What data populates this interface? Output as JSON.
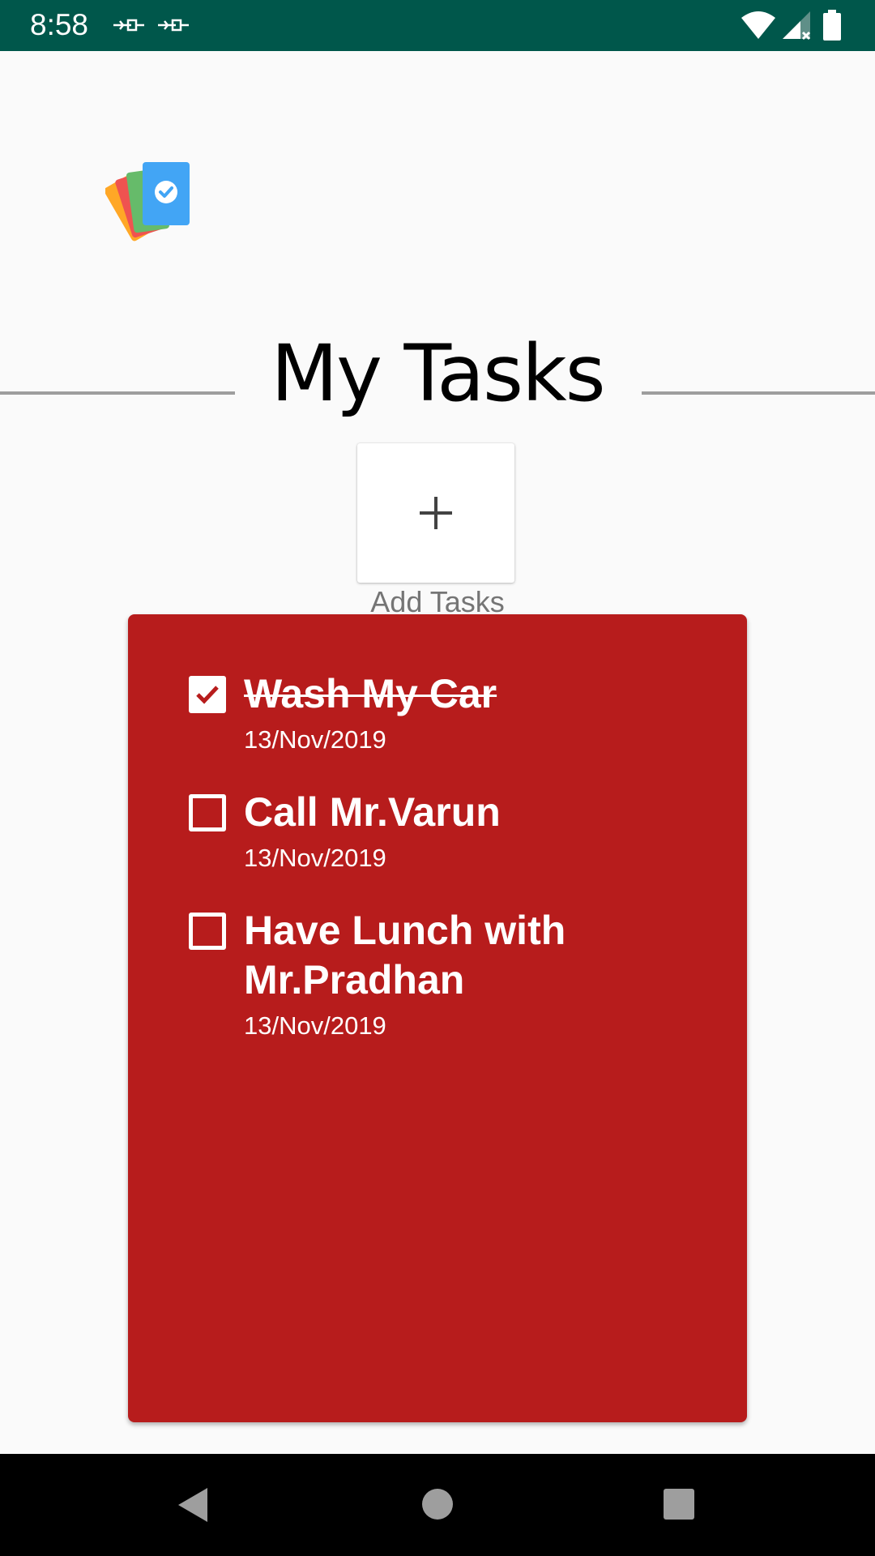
{
  "status_bar": {
    "time": "8:58",
    "notification_icons": [
      "usb-debug-icon",
      "usb-debug-icon"
    ],
    "system_icons": [
      "wifi-icon",
      "cellular-signal-icon",
      "battery-icon"
    ],
    "background": "#00574b"
  },
  "header": {
    "logo_icon": "task-cards-logo-icon",
    "title": "My Tasks"
  },
  "add_task": {
    "icon": "plus-icon",
    "label": "Add Tasks"
  },
  "tasks": [
    {
      "title": "Wash My Car",
      "date": "13/Nov/2019",
      "completed": true
    },
    {
      "title": "Call Mr.Varun",
      "date": "13/Nov/2019",
      "completed": false
    },
    {
      "title": "Have Lunch with Mr.Pradhan",
      "date": "13/Nov/2019",
      "completed": false
    }
  ],
  "card_color": "#b71c1c",
  "nav_bar": {
    "icons": [
      "back-icon",
      "home-icon",
      "recents-icon"
    ]
  }
}
